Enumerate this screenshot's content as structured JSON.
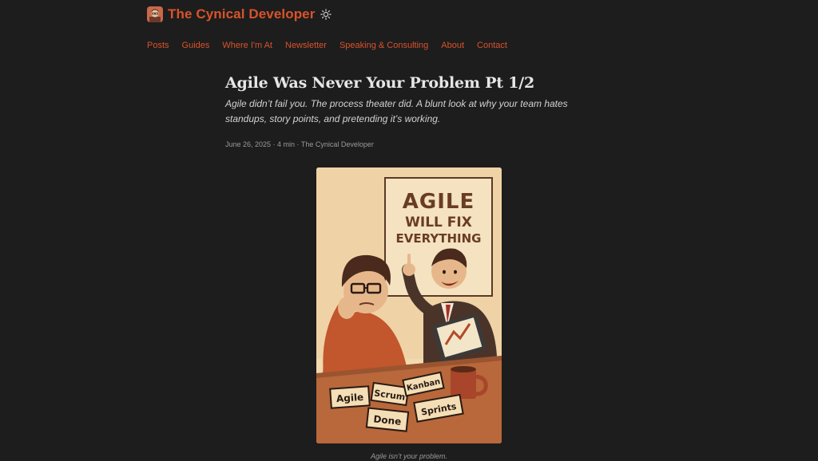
{
  "site": {
    "title": "The Cynical Developer",
    "theme_toggle_icon": "sun-icon"
  },
  "nav": {
    "items": [
      {
        "label": "Posts"
      },
      {
        "label": "Guides"
      },
      {
        "label": "Where I'm At"
      },
      {
        "label": "Newsletter"
      },
      {
        "label": "Speaking & Consulting"
      },
      {
        "label": "About"
      },
      {
        "label": "Contact"
      }
    ]
  },
  "article": {
    "title": "Agile Was Never Your Problem Pt 1/2",
    "summary": "Agile didn’t fail you. The process theater did. A blunt look at why your team hates standups, story points, and pretending it’s working.",
    "meta": "June 26, 2025 · 4 min · The Cynical Developer",
    "hero": {
      "sign_line1": "AGILE",
      "sign_line2": "WILL FIX",
      "sign_line3": "EVERYTHING",
      "cards": [
        "Agile",
        "Scrum",
        "Kanban",
        "Done",
        "Sprints"
      ],
      "caption": "Agile isn’t your problem."
    }
  },
  "colors": {
    "background": "#1d1d1d",
    "accent": "#d9532b",
    "title_text": "#e6e6e6",
    "muted_text": "#9a9a9a"
  }
}
